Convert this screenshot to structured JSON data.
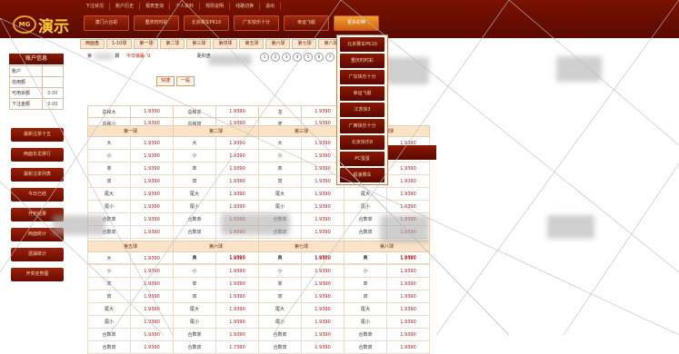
{
  "header": {
    "top_links": [
      "下注状况",
      "账户历史",
      "报表查询",
      "个人资料",
      "规则说明",
      "线路切换",
      "退出"
    ],
    "logo_badge": "MG",
    "logo_text": "演示",
    "nav": [
      "澳门六合彩",
      "重庆时时彩",
      "北京赛车PK10",
      "广东快乐十分",
      "幸运飞艇",
      "更多彩种"
    ]
  },
  "subtabs": [
    "两面盘",
    "1-10球",
    "第一球",
    "第二球",
    "第三球",
    "第四球",
    "第五球",
    "第六球",
    "第七球",
    "第八球"
  ],
  "sidebar": {
    "title": "账户信息",
    "rows": [
      [
        "账户",
        ""
      ],
      [
        "信用额",
        ""
      ],
      [
        "可用余额",
        "0.00"
      ],
      [
        "下注金额",
        "0.00"
      ]
    ],
    "buttons": [
      "最新注单十五",
      "两面长龙排行",
      "最新注单列表",
      "今日已结",
      "开奖结果",
      "两面统计",
      "遗漏统计",
      "开奖走势图"
    ]
  },
  "main": {
    "period_label": "第",
    "period_label2": "期",
    "draw_label": "今日输赢: 0",
    "time_label": "距封盘",
    "balls": [
      "1",
      "2",
      "3",
      "4",
      "5",
      "6",
      "7",
      "8",
      "9"
    ],
    "chips": [
      "快捷",
      "一般"
    ],
    "summary": [
      [
        "总和大",
        "1.9390",
        "总和单",
        "1.9390",
        "龙",
        "1.9390"
      ],
      [
        "总和小",
        "1.9390",
        "总和双",
        "1.9390",
        "虎",
        "1.9390"
      ]
    ],
    "section1_headers": [
      "第一球",
      "第二球",
      "第三球",
      "第四球"
    ],
    "section1_rows": [
      [
        "大",
        "1.9390",
        "大",
        "1.9390",
        "大",
        "1.9390",
        "大",
        "1.9390"
      ],
      [
        "小",
        "1.9390",
        "小",
        "1.9390",
        "小",
        "1.9390",
        "小",
        "1.9390"
      ],
      [
        "单",
        "1.9390",
        "单",
        "1.9390",
        "单",
        "1.9390",
        "单",
        "1.9390"
      ],
      [
        "双",
        "1.9390",
        "双",
        "1.9390",
        "双",
        "1.9390",
        "双",
        "1.9390"
      ],
      [
        "尾大",
        "1.9390",
        "尾大",
        "1.9390",
        "尾大",
        "1.9390",
        "尾大",
        "1.9390"
      ],
      [
        "尾小",
        "1.9390",
        "尾小",
        "1.9390",
        "尾小",
        "1.9390",
        "尾小",
        "1.9390"
      ],
      [
        "合数单",
        "1.9390",
        "合数单",
        "1.9390",
        "合数单",
        "1.9390",
        "合数单",
        "1.9390"
      ],
      [
        "合数双",
        "1.9390",
        "合数双",
        "1.9390",
        "合数双",
        "1.9390",
        "合数双",
        "1.9390"
      ],
      [
        "",
        "",
        "东",
        "1.9390",
        "东",
        "1.9390",
        "东",
        "1.9390"
      ],
      [
        "",
        "",
        "西",
        "1.9390",
        "西",
        "1.9390",
        "西",
        "1.9390"
      ]
    ],
    "section2_headers": [
      "第五球",
      "第六球",
      "第七球",
      "第八球"
    ],
    "section2_rows": [
      [
        "大",
        "1.9390",
        "大",
        "1.9390",
        "大",
        "1.9390",
        "大",
        "1.9390"
      ],
      [
        "小",
        "1.9390",
        "小",
        "1.9390",
        "小",
        "1.9390",
        "小",
        "1.9390"
      ],
      [
        "单",
        "1.9390",
        "单",
        "1.9390",
        "单",
        "1.9390",
        "单",
        "1.9390"
      ],
      [
        "双",
        "1.9390",
        "双",
        "1.9390",
        "双",
        "1.9390",
        "双",
        "1.9390"
      ],
      [
        "尾大",
        "1.9390",
        "尾大",
        "1.9390",
        "尾大",
        "1.9390",
        "尾大",
        "1.9390"
      ],
      [
        "尾小",
        "1.9390",
        "尾小",
        "1.9390",
        "尾小",
        "1.9390",
        "尾小",
        "1.9390"
      ],
      [
        "合数单",
        "1.9390",
        "合数单",
        "1.9390",
        "合数单",
        "1.9390",
        "合数单",
        "1.9390"
      ],
      [
        "合数双",
        "1.9390",
        "合数双",
        "1.7390",
        "合数双",
        "1.9390",
        "合数双",
        "1.9390"
      ]
    ]
  },
  "dropdown": [
    "北京赛车PK10",
    "重庆时时彩",
    "广东快乐十分",
    "幸运飞艇",
    "江苏快3",
    "广西快乐十分",
    "北京快乐8",
    "PC蛋蛋",
    "极速赛车"
  ],
  "colors": {
    "header": "#6a0e00",
    "accent": "#e08020",
    "odds": "#c01010"
  }
}
